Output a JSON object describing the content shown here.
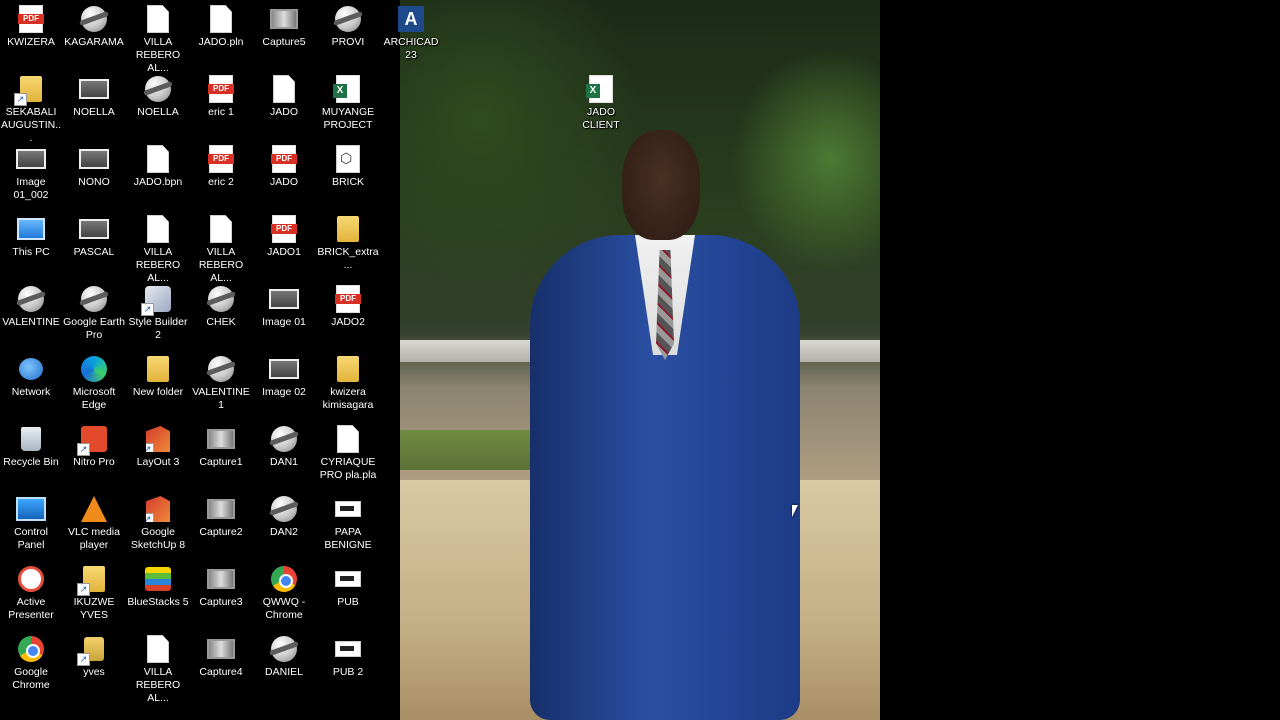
{
  "desktop": {
    "columns": [
      [
        {
          "label": "KWIZERA",
          "icon": "pdf-file-icon"
        },
        {
          "label": "SEKABALI AUGUSTIN...",
          "icon": "folder-shortcut-icon"
        },
        {
          "label": "Image 01_002",
          "icon": "image-file-icon"
        },
        {
          "label": "This PC",
          "icon": "this-pc-icon"
        },
        {
          "label": "VALENTINE",
          "icon": "google-earth-icon"
        },
        {
          "label": "Network",
          "icon": "network-icon"
        },
        {
          "label": "Recycle Bin",
          "icon": "recycle-bin-icon"
        },
        {
          "label": "Control Panel",
          "icon": "control-panel-icon"
        },
        {
          "label": "Active Presenter",
          "icon": "active-presenter-icon"
        },
        {
          "label": "Google Chrome",
          "icon": "chrome-icon"
        }
      ],
      [
        {
          "label": "KAGARAMA",
          "icon": "google-earth-icon"
        },
        {
          "label": "NOELLA",
          "icon": "image-file-icon"
        },
        {
          "label": "NONO",
          "icon": "image-file-icon"
        },
        {
          "label": "PASCAL",
          "icon": "image-file-icon"
        },
        {
          "label": "Google Earth Pro",
          "icon": "google-earth-icon"
        },
        {
          "label": "Microsoft Edge",
          "icon": "edge-icon"
        },
        {
          "label": "Nitro Pro",
          "icon": "nitro-pro-icon"
        },
        {
          "label": "VLC media player",
          "icon": "vlc-icon"
        },
        {
          "label": "IKUZWE YVES",
          "icon": "folder-shortcut-icon"
        },
        {
          "label": "yves",
          "icon": "file-shortcut-icon"
        }
      ],
      [
        {
          "label": "VILLA REBERO AL...",
          "icon": "document-icon"
        },
        {
          "label": "NOELLA",
          "icon": "google-earth-icon"
        },
        {
          "label": "JADO.bpn",
          "icon": "document-icon"
        },
        {
          "label": "VILLA REBERO AL...",
          "icon": "document-icon"
        },
        {
          "label": "Style Builder 2",
          "icon": "style-builder-icon"
        },
        {
          "label": "New folder",
          "icon": "folder-icon"
        },
        {
          "label": "LayOut 3",
          "icon": "layout-icon"
        },
        {
          "label": "Google SketchUp 8",
          "icon": "sketchup-icon"
        },
        {
          "label": "BlueStacks 5",
          "icon": "bluestacks-icon"
        },
        {
          "label": "VILLA REBERO AL...",
          "icon": "document-icon"
        }
      ],
      [
        {
          "label": "JADO.pln",
          "icon": "document-icon"
        },
        {
          "label": "eric 1",
          "icon": "pdf-file-icon"
        },
        {
          "label": "eric 2",
          "icon": "pdf-file-icon"
        },
        {
          "label": "VILLA REBERO AL...",
          "icon": "document-icon"
        },
        {
          "label": "CHEK",
          "icon": "google-earth-icon"
        },
        {
          "label": "VALENTINE 1",
          "icon": "google-earth-icon"
        },
        {
          "label": "Capture1",
          "icon": "capture-icon"
        },
        {
          "label": "Capture2",
          "icon": "capture-icon"
        },
        {
          "label": "Capture3",
          "icon": "capture-icon"
        },
        {
          "label": "Capture4",
          "icon": "capture-icon"
        }
      ],
      [
        {
          "label": "Capture5",
          "icon": "capture-icon"
        },
        {
          "label": "JADO",
          "icon": "archicad-file-icon"
        },
        {
          "label": "JADO",
          "icon": "pdf-file-icon"
        },
        {
          "label": "JADO1",
          "icon": "pdf-file-icon"
        },
        {
          "label": "Image 01",
          "icon": "image-file-icon"
        },
        {
          "label": "Image 02",
          "icon": "image-file-icon"
        },
        {
          "label": "DAN1",
          "icon": "google-earth-icon"
        },
        {
          "label": "DAN2",
          "icon": "google-earth-icon"
        },
        {
          "label": "QWWQ - Chrome",
          "icon": "chrome-icon"
        },
        {
          "label": "DANIEL",
          "icon": "google-earth-icon"
        }
      ],
      [
        {
          "label": "PROVI",
          "icon": "google-earth-icon"
        },
        {
          "label": "MUYANGE PROJECT",
          "icon": "excel-file-icon"
        },
        {
          "label": "BRICK",
          "icon": "brick-file-icon"
        },
        {
          "label": "BRICK_extra...",
          "icon": "folder-icon"
        },
        {
          "label": "JADO2",
          "icon": "pdf-file-icon"
        },
        {
          "label": "kwizera kimisagara",
          "icon": "folder-icon"
        },
        {
          "label": "CYRIAQUE PRO pla.pla",
          "icon": "document-icon"
        },
        {
          "label": "PAPA BENIGNE",
          "icon": "publisher-icon"
        },
        {
          "label": "PUB",
          "icon": "publisher-icon"
        },
        {
          "label": "PUB 2",
          "icon": "publisher-icon"
        }
      ],
      [
        {
          "label": "ARCHICAD 23",
          "icon": "archicad-icon"
        }
      ]
    ],
    "extra": {
      "label": "JADO CLIENT",
      "icon": "excel-file-icon"
    }
  }
}
